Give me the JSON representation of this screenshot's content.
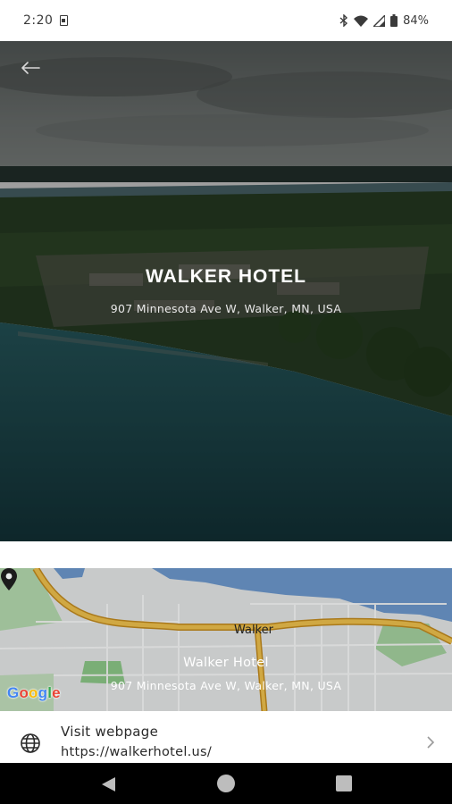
{
  "status_bar": {
    "time": "2:20",
    "battery": "84%",
    "icons": [
      "sim-card-icon",
      "bluetooth-icon",
      "wifi-icon",
      "signal-icon",
      "battery-icon"
    ]
  },
  "hero": {
    "title": "WALKER HOTEL",
    "address": "907 Minnesota Ave W, Walker, MN, USA",
    "back_icon": "arrow-left-icon"
  },
  "map": {
    "place_label": "Walker",
    "title": "Walker Hotel",
    "address": "907 Minnesota Ave W, Walker, MN, USA",
    "attribution": "Google",
    "pin_icon": "map-pin-icon"
  },
  "webpage": {
    "label": "Visit webpage",
    "url": "https://walkerhotel.us/",
    "icon": "globe-icon",
    "chevron": "chevron-right-icon"
  },
  "nav_bar": {
    "icons": [
      "nav-back-icon",
      "nav-home-icon",
      "nav-recents-icon"
    ]
  },
  "colors": {
    "water": "#1d5961",
    "forest": "#2f4a2a",
    "map_water": "#6f9bd1",
    "map_road": "#e8b23a",
    "map_green": "#a8d5a2"
  }
}
